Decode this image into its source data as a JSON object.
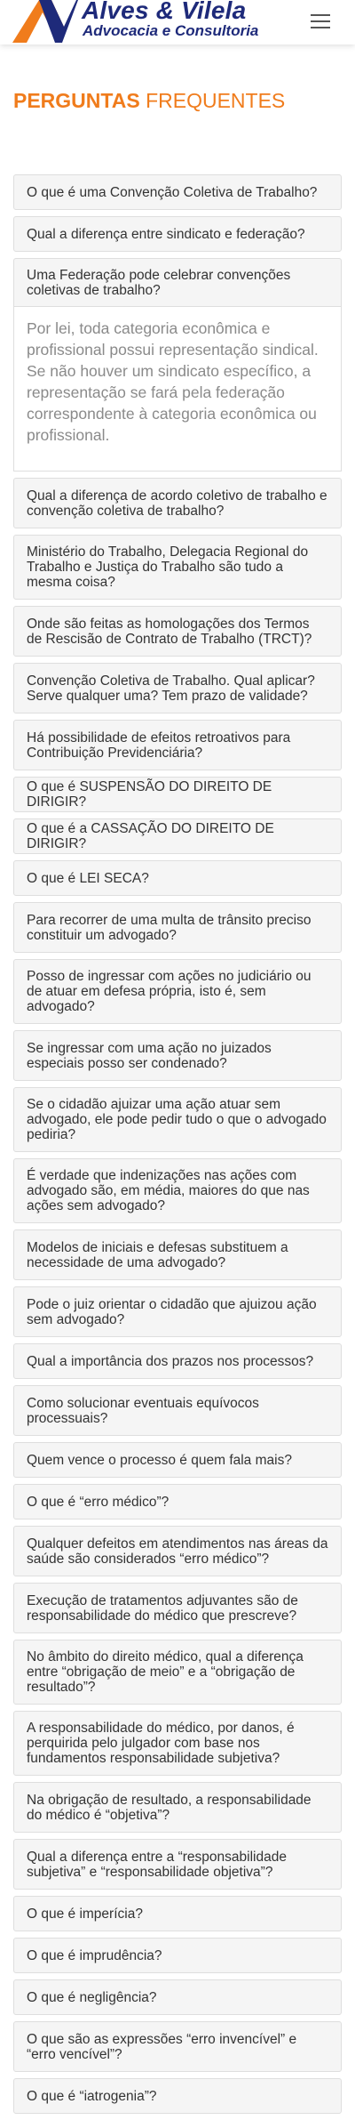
{
  "brand": {
    "name": "Alves & Vilela",
    "subtitle": "Advocacia e Consultoria",
    "colors": {
      "navy": "#1e2a7a",
      "orange": "#f07c1c"
    }
  },
  "header": {
    "menu_icon": "hamburger-menu-icon"
  },
  "page": {
    "title_bold": "PERGUNTAS",
    "title_light": "FREQUENTES"
  },
  "faq": {
    "items": [
      {
        "question": "O que é uma Convenção Coletiva de Trabalho?"
      },
      {
        "question": "Qual a diferença entre sindicato e federação?"
      },
      {
        "question": "Uma Federação pode celebrar convenções coletivas de trabalho?",
        "answer": "Por lei, toda categoria econômica e profissional possui representação sindical. Se não houver um sindicato específico, a representação se fará pela federação correspondente à categoria econômica ou profissional.",
        "expanded": true
      },
      {
        "question": "Qual a diferença de acordo coletivo de trabalho e convenção coletiva de trabalho?"
      },
      {
        "question": "Ministério do Trabalho, Delegacia Regional do Trabalho e Justiça do Trabalho são tudo a mesma coisa?"
      },
      {
        "question": "Onde são feitas as homologações dos Termos de Rescisão de Contrato de Trabalho (TRCT)?"
      },
      {
        "question": "Convenção Coletiva de Trabalho. Qual aplicar? Serve qualquer uma? Tem prazo de validade?"
      },
      {
        "question": "Há possibilidade de efeitos retroativos para Contribuição Previdenciária?"
      },
      {
        "question": "O que é SUSPENSÃO DO DIREITO DE DIRIGIR?"
      },
      {
        "question": "O que é a CASSAÇÃO DO DIREITO DE DIRIGIR?"
      },
      {
        "question": "O que é LEI SECA?"
      },
      {
        "question": "Para recorrer de uma multa de trânsito preciso constituir um advogado?"
      },
      {
        "question": "Posso de ingressar com ações no judiciário ou de atuar em defesa própria, isto é, sem advogado?"
      },
      {
        "question": "Se ingressar com uma ação no juizados especiais posso ser condenado?"
      },
      {
        "question": "Se o cidadão ajuizar uma ação atuar sem advogado, ele pode pedir tudo o que o advogado pediria?"
      },
      {
        "question": "É verdade que indenizações nas ações com advogado são, em média, maiores do que nas ações sem advogado?"
      },
      {
        "question": "Modelos de iniciais e defesas substituem a necessidade de uma advogado?"
      },
      {
        "question": "Pode o juiz orientar o cidadão que ajuizou ação sem advogado?"
      },
      {
        "question": "Qual a importância dos prazos nos processos?"
      },
      {
        "question": "Como solucionar eventuais equívocos processuais?"
      },
      {
        "question": "Quem vence o processo é quem fala mais?"
      },
      {
        "question": "O que é “erro médico”?"
      },
      {
        "question": "Qualquer defeitos em atendimentos nas áreas da saúde são considerados “erro médico”?"
      },
      {
        "question": "Execução de tratamentos adjuvantes são de responsabilidade do médico que prescreve?"
      },
      {
        "question": "No âmbito do direito médico, qual a diferença entre “obrigação de meio” e a “obrigação de resultado”?"
      },
      {
        "question": "A responsabilidade do médico, por danos, é perquirida pelo julgador com base nos fundamentos responsabilidade subjetiva?"
      },
      {
        "question": "Na obrigação de resultado, a responsabilidade do médico é “objetiva”?"
      },
      {
        "question": "Qual a diferença entre a “responsabilidade subjetiva” e “responsabilidade objetiva”?"
      },
      {
        "question": "O que é imperícia?"
      },
      {
        "question": "O que é imprudência?"
      },
      {
        "question": "O que é negligência?"
      },
      {
        "question": "O que são as expressões “erro invencível” e “erro vencível”?"
      },
      {
        "question": "O que é “iatrogenia”?"
      }
    ]
  }
}
